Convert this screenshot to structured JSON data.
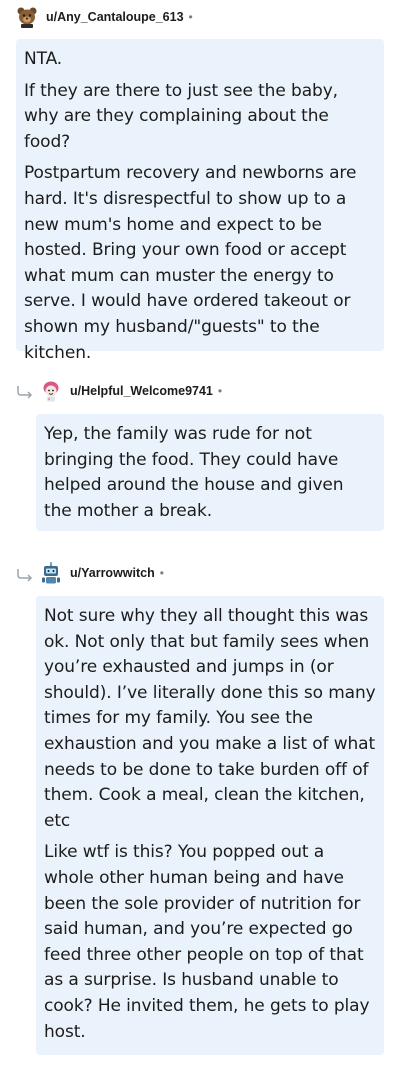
{
  "comments": [
    {
      "username": "u/Any_Cantaloupe_613",
      "separator": "•",
      "avatar_icon": "bear-avatar-icon",
      "paragraphs": [
        "NTA.",
        "If they are there to just see the baby, why are they complaining about the food?",
        "Postpartum recovery and newborns are hard. It's disrespectful to show up to a new mum's home and expect to be hosted. Bring your own food or accept what mum can muster the energy to serve. I would have ordered takeout or shown my husband/\"guests\" to the kitchen."
      ]
    },
    {
      "username": "u/Helpful_Welcome9741",
      "separator": "•",
      "avatar_icon": "pink-hair-avatar-icon",
      "reply_icon": "reply-arrow-icon",
      "paragraphs": [
        "Yep, the family was rude for not bringing the food. They could have helped around the house and given the mother a break."
      ]
    },
    {
      "username": "u/Yarrowwitch",
      "separator": "•",
      "avatar_icon": "robot-avatar-icon",
      "reply_icon": "reply-arrow-icon",
      "paragraphs": [
        "Not sure why they all thought this was ok. Not only that but family sees when you’re exhausted and jumps in (or should). I’ve literally done this so many times for my family. You see the exhaustion and you make a list of what needs to be done to take burden off of them. Cook a meal, clean the kitchen, etc",
        "Like wtf is this? You popped out a whole other human being and have been the sole provider of nutrition for said human, and you’re expected go feed three other people on top of that as a surprise. Is husband unable to cook? He invited them, he gets to play host."
      ]
    }
  ],
  "colors": {
    "bubble_bg": "#eaf3fb",
    "text": "#1c1c1c",
    "meta": "#7c7c7c"
  }
}
